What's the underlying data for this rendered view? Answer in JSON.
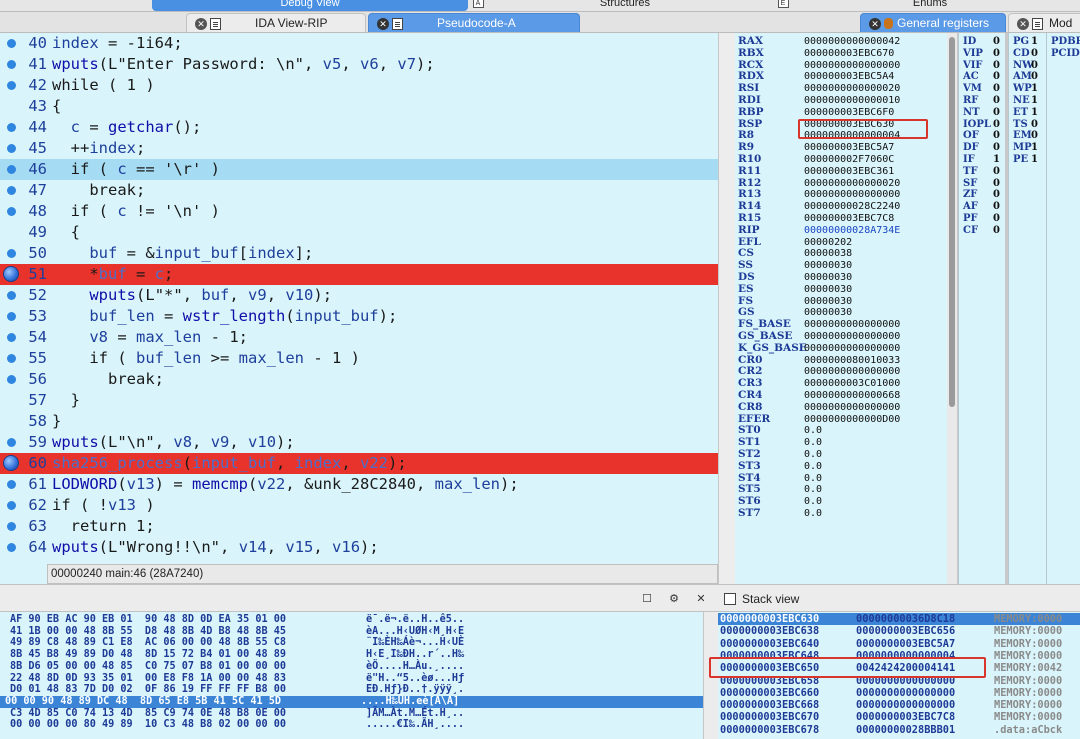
{
  "window": {
    "top_tabs": [
      {
        "label": "Debug View",
        "selected": true
      },
      {
        "label": "Structures",
        "selected": false
      },
      {
        "label": "Enums",
        "selected": false
      }
    ],
    "tabs": [
      {
        "label": "IDA View-RIP"
      },
      {
        "label": "Pseudocode-A"
      },
      {
        "label": "General registers"
      },
      {
        "label": "Mod"
      }
    ]
  },
  "pseudocode": {
    "lines": [
      {
        "num": "40",
        "text": "index = -1i64;",
        "mark": "dot",
        "hl": ""
      },
      {
        "num": "41",
        "text": "wputs(L\"Enter Password: \\n\", v5, v6, v7);",
        "mark": "dot",
        "hl": ""
      },
      {
        "num": "42",
        "text": "while ( 1 )",
        "mark": "dot",
        "hl": ""
      },
      {
        "num": "43",
        "text": "{",
        "mark": "",
        "hl": ""
      },
      {
        "num": "44",
        "text": "  c = getchar();",
        "mark": "dot",
        "hl": ""
      },
      {
        "num": "45",
        "text": "  ++index;",
        "mark": "dot",
        "hl": ""
      },
      {
        "num": "46",
        "text": "  if ( c == '\\r' )",
        "mark": "dot",
        "hl": "blue"
      },
      {
        "num": "47",
        "text": "    break;",
        "mark": "dot",
        "hl": ""
      },
      {
        "num": "48",
        "text": "  if ( c != '\\n' )",
        "mark": "dot",
        "hl": ""
      },
      {
        "num": "49",
        "text": "  {",
        "mark": "",
        "hl": ""
      },
      {
        "num": "50",
        "text": "    buf = &input_buf[index];",
        "mark": "dot",
        "hl": ""
      },
      {
        "num": "51",
        "text": "    *buf = c;",
        "mark": "bp",
        "hl": "red"
      },
      {
        "num": "52",
        "text": "    wputs(L\"*\", buf, v9, v10);",
        "mark": "dot",
        "hl": ""
      },
      {
        "num": "53",
        "text": "    buf_len = wstr_length(input_buf);",
        "mark": "dot",
        "hl": ""
      },
      {
        "num": "54",
        "text": "    v8 = max_len - 1;",
        "mark": "dot",
        "hl": ""
      },
      {
        "num": "55",
        "text": "    if ( buf_len >= max_len - 1 )",
        "mark": "dot",
        "hl": ""
      },
      {
        "num": "56",
        "text": "      break;",
        "mark": "dot",
        "hl": ""
      },
      {
        "num": "57",
        "text": "  }",
        "mark": "",
        "hl": ""
      },
      {
        "num": "58",
        "text": "}",
        "mark": "",
        "hl": ""
      },
      {
        "num": "59",
        "text": "wputs(L\"\\n\", v8, v9, v10);",
        "mark": "dot",
        "hl": ""
      },
      {
        "num": "60",
        "text": "sha256_process(input_buf, index, v22);",
        "mark": "bp",
        "hl": "red"
      },
      {
        "num": "61",
        "text": "LODWORD(v13) = memcmp(v22, &unk_28C2840, max_len);",
        "mark": "dot",
        "hl": ""
      },
      {
        "num": "62",
        "text": "if ( !v13 )",
        "mark": "dot",
        "hl": ""
      },
      {
        "num": "63",
        "text": "  return 1;",
        "mark": "dot",
        "hl": ""
      },
      {
        "num": "64",
        "text": "wputs(L\"Wrong!!\\n\", v14, v15, v16);",
        "mark": "dot",
        "hl": ""
      }
    ],
    "status": "00000240 main:46 (28A7240)"
  },
  "registers": [
    {
      "name": "RAX",
      "value": "0000000000000042"
    },
    {
      "name": "RBX",
      "value": "000000003EBC670"
    },
    {
      "name": "RCX",
      "value": "0000000000000000"
    },
    {
      "name": "RDX",
      "value": "000000003EBC5A4"
    },
    {
      "name": "RSI",
      "value": "0000000000000020"
    },
    {
      "name": "RDI",
      "value": "0000000000000010"
    },
    {
      "name": "RBP",
      "value": "000000003EBC6F0"
    },
    {
      "name": "RSP",
      "value": "000000003EBC630"
    },
    {
      "name": "R8",
      "value": "0000000000000004"
    },
    {
      "name": "R9",
      "value": "000000003EBC5A7"
    },
    {
      "name": "R10",
      "value": "000000002F7060C"
    },
    {
      "name": "R11",
      "value": "000000003EBC361"
    },
    {
      "name": "R12",
      "value": "0000000000000020"
    },
    {
      "name": "R13",
      "value": "0000000000000000"
    },
    {
      "name": "R14",
      "value": "00000000028C2240"
    },
    {
      "name": "R15",
      "value": "000000003EBC7C8"
    },
    {
      "name": "RIP",
      "value": "00000000028A734E"
    },
    {
      "name": "EFL",
      "value": "00000202"
    },
    {
      "name": "CS",
      "value": "00000038"
    },
    {
      "name": "SS",
      "value": "00000030"
    },
    {
      "name": "DS",
      "value": "00000030"
    },
    {
      "name": "ES",
      "value": "00000030"
    },
    {
      "name": "FS",
      "value": "00000030"
    },
    {
      "name": "GS",
      "value": "00000030"
    },
    {
      "name": "FS_BASE",
      "value": "0000000000000000"
    },
    {
      "name": "GS_BASE",
      "value": "0000000000000000"
    },
    {
      "name": "K_GS_BASE",
      "value": "0000000000000000"
    },
    {
      "name": "CR0",
      "value": "0000000080010033"
    },
    {
      "name": "CR2",
      "value": "0000000000000000"
    },
    {
      "name": "CR3",
      "value": "0000000003C01000"
    },
    {
      "name": "CR4",
      "value": "0000000000000668"
    },
    {
      "name": "CR8",
      "value": "0000000000000000"
    },
    {
      "name": "EFER",
      "value": "0000000000000D00"
    },
    {
      "name": "ST0",
      "value": "0.0"
    },
    {
      "name": "ST1",
      "value": "0.0"
    },
    {
      "name": "ST2",
      "value": "0.0"
    },
    {
      "name": "ST3",
      "value": "0.0"
    },
    {
      "name": "ST4",
      "value": "0.0"
    },
    {
      "name": "ST5",
      "value": "0.0"
    },
    {
      "name": "ST6",
      "value": "0.0"
    },
    {
      "name": "ST7",
      "value": "0.0"
    }
  ],
  "flags_a": [
    {
      "name": "ID",
      "value": "0"
    },
    {
      "name": "VIP",
      "value": "0"
    },
    {
      "name": "VIF",
      "value": "0"
    },
    {
      "name": "AC",
      "value": "0"
    },
    {
      "name": "VM",
      "value": "0"
    },
    {
      "name": "RF",
      "value": "0"
    },
    {
      "name": "NT",
      "value": "0"
    },
    {
      "name": "IOPL",
      "value": "0"
    },
    {
      "name": "OF",
      "value": "0"
    },
    {
      "name": "DF",
      "value": "0"
    },
    {
      "name": "IF",
      "value": "1"
    },
    {
      "name": "TF",
      "value": "0"
    },
    {
      "name": "SF",
      "value": "0"
    },
    {
      "name": "ZF",
      "value": "0"
    },
    {
      "name": "AF",
      "value": "0"
    },
    {
      "name": "PF",
      "value": "0"
    },
    {
      "name": "CF",
      "value": "0"
    }
  ],
  "flags_b": [
    {
      "name": "PG",
      "value": "1"
    },
    {
      "name": "CD",
      "value": "0"
    },
    {
      "name": "NW",
      "value": "0"
    },
    {
      "name": "AM",
      "value": "0"
    },
    {
      "name": "WP",
      "value": "1"
    },
    {
      "name": "NE",
      "value": "1"
    },
    {
      "name": "ET",
      "value": "1"
    },
    {
      "name": "TS",
      "value": "0"
    },
    {
      "name": "EM",
      "value": "0"
    },
    {
      "name": "MP",
      "value": "1"
    },
    {
      "name": "PE",
      "value": "1"
    }
  ],
  "flags_c": [
    "PDBR",
    "PCID"
  ],
  "hex_rows": [
    {
      "bytes": "AF 90 EB AC 90 EB 01  90 48 8D 0D EA 35 01 00",
      "ascii": "ë¯.ë¬.ë..H..ê5.."
    },
    {
      "bytes": "41 1B 00 00 48 8B 55  D8 48 8B 4D B8 48 8B 45",
      "ascii": "èA...H‹UØH‹M¸H‹E"
    },
    {
      "bytes": "49 89 C8 48 89 C1 E8  AC 06 00 00 48 8B 55 C8",
      "ascii": "¨I‰ÈH‰Áè¬...H‹UÈ"
    },
    {
      "bytes": "8B 45 B8 49 89 D0 48  8D 15 72 B4 01 00 48 89",
      "ascii": "H‹E¸I‰ÐH..r´..H‰"
    },
    {
      "bytes": "8B D6 05 00 00 48 85  C0 75 07 B8 01 00 00 00",
      "ascii": "èÖ....H…Àu.¸...."
    },
    {
      "bytes": "22 48 8D 0D 93 35 01  00 E8 F8 1A 00 00 48 83",
      "ascii": "ë\"H..“5..èø...Hƒ"
    },
    {
      "bytes": "D0 01 48 83 7D D0 02  0F 86 19 FF FF FF B8 00",
      "ascii": "EÐ.Hƒ}Ð..†.ÿÿÿ¸."
    },
    {
      "bytes": "00 00 90 48 89 DC 48  8D 65 E8 5B 41 5C 41 5D",
      "ascii": "....H‰ÜH.eè[A\\A]"
    },
    {
      "bytes": "C3 4D 85 C0 74 13 4D  85 C9 74 0E 48 B8 0E 00",
      "ascii": "]ÃM…Àt.M…Ét.H¸.."
    },
    {
      "bytes": "00 00 00 00 80 49 89  10 C3 48 B8 02 00 00 00",
      "ascii": ".....€I‰.ÃH¸...."
    }
  ],
  "stack_view": {
    "title": "Stack view",
    "rows": [
      {
        "addr": "0000000003EBC630",
        "value": "00000000036D8C18",
        "mem": "MEMORY:0000"
      },
      {
        "addr": "0000000003EBC638",
        "value": "0000000003EBC656",
        "mem": "MEMORY:0000"
      },
      {
        "addr": "0000000003EBC640",
        "value": "0000000003EBC5A7",
        "mem": "MEMORY:0000"
      },
      {
        "addr": "0000000003EBC648",
        "value": "0000000000000004",
        "mem": "MEMORY:0000"
      },
      {
        "addr": "0000000003EBC650",
        "value": "0042424200004141",
        "mem": "MEMORY:0042"
      },
      {
        "addr": "0000000003EBC658",
        "value": "0000000000000000",
        "mem": "MEMORY:0000"
      },
      {
        "addr": "0000000003EBC660",
        "value": "0000000000000000",
        "mem": "MEMORY:0000"
      },
      {
        "addr": "0000000003EBC668",
        "value": "0000000000000000",
        "mem": "MEMORY:0000"
      },
      {
        "addr": "0000000003EBC670",
        "value": "0000000003EBC7C8",
        "mem": "MEMORY:0000"
      },
      {
        "addr": "0000000003EBC678",
        "value": "00000000028BBB01",
        "mem": ".data:aCbck"
      }
    ]
  }
}
